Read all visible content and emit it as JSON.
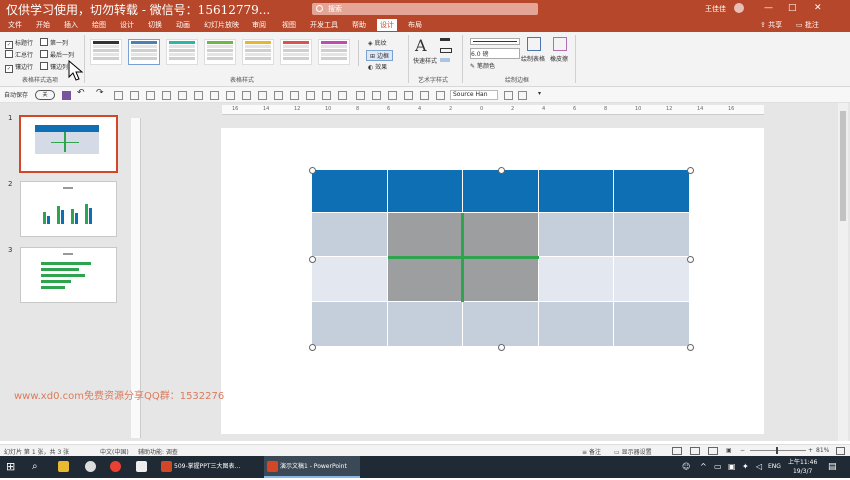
{
  "overlay": {
    "watermark_top": "仅供学习使用，切勿转载 - 微信号：15612779...",
    "watermark_bottom": "www.xd0.com免费资源分享QQ群：1532276"
  },
  "titlebar": {
    "search_text": "搜索",
    "user_name": "王佳佳",
    "window_buttons": [
      "—",
      "□",
      "✕"
    ]
  },
  "menubar": {
    "tabs": [
      "文件",
      "开始",
      "插入",
      "绘图",
      "设计",
      "切换",
      "动画",
      "幻灯片放映",
      "审阅",
      "视图",
      "开发工具",
      "帮助",
      "设计",
      "布局"
    ],
    "active_tab": "设计",
    "share_label": "共享",
    "comment_label": "批注"
  },
  "ribbon": {
    "table_style_options": {
      "options": [
        {
          "label": "标题行",
          "checked": true
        },
        {
          "label": "第一列",
          "checked": false
        },
        {
          "label": "汇总行",
          "checked": false
        },
        {
          "label": "最后一列",
          "checked": false
        },
        {
          "label": "镶边行",
          "checked": true
        },
        {
          "label": "镶边列",
          "checked": false
        }
      ],
      "group_label": "表格样式选项"
    },
    "table_styles": {
      "group_label": "表格样式",
      "shading_label": "底纹",
      "border_label": "边框",
      "effects_label": "效果",
      "style_colors": [
        "#333333",
        "#4a7fb8",
        "#2fb5a5",
        "#6fb646",
        "#e3b72f",
        "#d9534f",
        "#c04bb5"
      ]
    },
    "wordart": {
      "group_label": "艺术字样式",
      "quick_styles_label": "快速样式"
    },
    "draw_borders": {
      "group_label": "绘制边框",
      "pen_weight": "6.0 磅",
      "pen_color_label": "笔颜色",
      "draw_table_label": "绘制表格",
      "eraser_label": "橡皮擦"
    }
  },
  "qat": {
    "autosave_label": "自动保存",
    "toggle_state": "关",
    "font_name": "Source Han"
  },
  "slides": {
    "numbers": [
      "1",
      "2",
      "3"
    ],
    "selected": 1
  },
  "table": {
    "rows": 4,
    "cols": 5,
    "header_color": "#0e6fb4",
    "band_light": "#e3e7ef",
    "band_dark": "#c5cedb",
    "highlight_color": "#9d9ea0",
    "line_color": "#2ea44f"
  },
  "status": {
    "slide_info": "幻灯片 第 1 张，共 3 张",
    "language": "中文(中国)",
    "accessibility": "辅助功能: 调查",
    "notes_label": "备注",
    "display_settings": "显示器设置",
    "zoom": "81%"
  },
  "taskbar": {
    "items": [
      {
        "label": "509-掌握PPT三大图表...",
        "active": false
      },
      {
        "label": "演示文稿1 - PowerPoint",
        "active": true
      }
    ],
    "ime": "ENG",
    "time": "上午11:46",
    "date": "19/3/7"
  }
}
